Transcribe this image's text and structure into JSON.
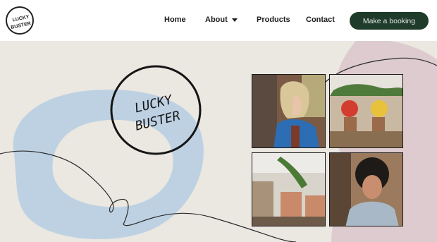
{
  "header": {
    "logo_text": [
      "LUCKY",
      "BUSTER"
    ],
    "nav": [
      {
        "label": "Home"
      },
      {
        "label": "About"
      },
      {
        "label": "Products"
      },
      {
        "label": "Contact"
      }
    ],
    "cta_label": "Make a booking"
  },
  "hero": {
    "logo_text": [
      "LUCKY",
      "BUSTER"
    ],
    "gallery": [
      {
        "icon": "photo-woman-blonde-icon"
      },
      {
        "icon": "photo-salon-mirrors-icon"
      },
      {
        "icon": "photo-salon-interior-icon"
      },
      {
        "icon": "photo-woman-curly-hair-icon"
      }
    ]
  },
  "colors": {
    "background": "#ebe7e1",
    "header": "#ffffff",
    "cta": "#1f3b2a",
    "blob_blue": "#bdd1e3",
    "blob_pink": "#ddcbd0"
  }
}
